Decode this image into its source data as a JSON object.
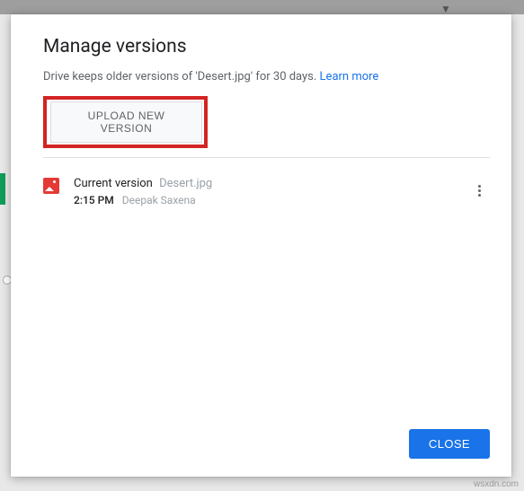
{
  "dialog": {
    "title": "Manage versions",
    "info_text": "Drive keeps older versions of 'Desert.jpg' for 30 days. ",
    "learn_more": "Learn more",
    "upload_button": "Upload new version",
    "close_button": "Close"
  },
  "version": {
    "label": "Current version",
    "filename": "Desert.jpg",
    "time": "2:15 PM",
    "author": "Deepak Saxena"
  },
  "watermark": "wsxdn.com"
}
